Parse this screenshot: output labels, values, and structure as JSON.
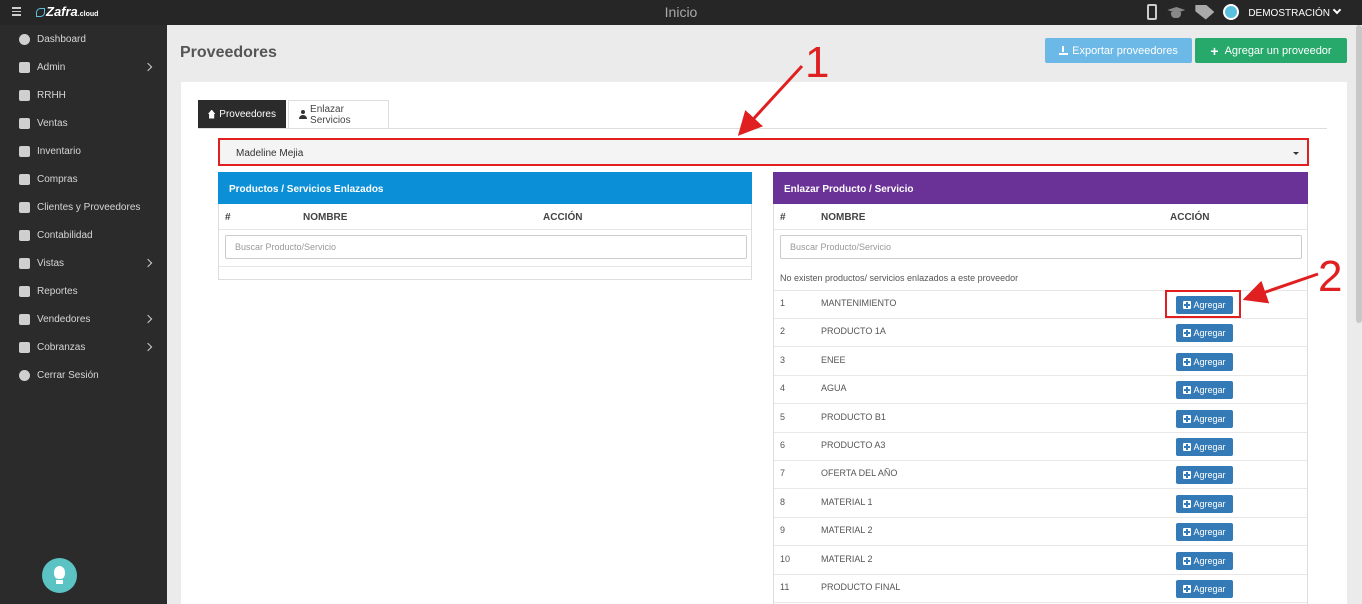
{
  "topbar": {
    "brand": "Zafra",
    "brand_suffix": ".cloud",
    "title": "Inicio",
    "user_name": "DEMOSTRACIÓN"
  },
  "sidebar": {
    "items": [
      {
        "label": "Dashboard",
        "icon": "globe-icon",
        "has_arrow": false
      },
      {
        "label": "Admin",
        "icon": "wrench-icon",
        "has_arrow": true
      },
      {
        "label": "RRHH",
        "icon": "paperclip-icon",
        "has_arrow": false
      },
      {
        "label": "Ventas",
        "icon": "money-icon",
        "has_arrow": false
      },
      {
        "label": "Inventario",
        "icon": "book-icon",
        "has_arrow": false
      },
      {
        "label": "Compras",
        "icon": "cart-icon",
        "has_arrow": false
      },
      {
        "label": "Clientes y Proveedores",
        "icon": "book-icon",
        "has_arrow": false
      },
      {
        "label": "Contabilidad",
        "icon": "paperclip-icon",
        "has_arrow": false
      },
      {
        "label": "Vistas",
        "icon": "edit-icon",
        "has_arrow": true
      },
      {
        "label": "Reportes",
        "icon": "list-icon",
        "has_arrow": false
      },
      {
        "label": "Vendedores",
        "icon": "user-icon",
        "has_arrow": true
      },
      {
        "label": "Cobranzas",
        "icon": "edit-icon",
        "has_arrow": true
      },
      {
        "label": "Cerrar Sesión",
        "icon": "power-icon",
        "has_arrow": false
      }
    ]
  },
  "header": {
    "title": "Proveedores",
    "export_label": "Exportar proveedores",
    "add_label": "Agregar un proveedor"
  },
  "tabs": {
    "active": "Proveedores",
    "inactive": "Enlazar Servicios"
  },
  "provider_select": {
    "value": "Madeline Mejia"
  },
  "left_panel": {
    "title": "Productos / Servicios Enlazados",
    "col_num": "#",
    "col_name": "NOMBRE",
    "col_action": "ACCIÓN",
    "search_placeholder": "Buscar Producto/Servicio"
  },
  "right_panel": {
    "title": "Enlazar Producto / Servicio",
    "col_num": "#",
    "col_name": "NOMBRE",
    "col_action": "ACCIÓN",
    "search_placeholder": "Buscar Producto/Servicio",
    "empty_message": "No existen productos/ servicios enlazados a este proveedor",
    "button_label": "Agregar",
    "rows": [
      {
        "num": "1",
        "name": "MANTENIMIENTO"
      },
      {
        "num": "2",
        "name": "PRODUCTO 1A"
      },
      {
        "num": "3",
        "name": "ENEE"
      },
      {
        "num": "4",
        "name": "AGUA"
      },
      {
        "num": "5",
        "name": "PRODUCTO B1"
      },
      {
        "num": "6",
        "name": "PRODUCTO A3"
      },
      {
        "num": "7",
        "name": "OFERTA DEL AÑO"
      },
      {
        "num": "8",
        "name": "MATERIAL 1"
      },
      {
        "num": "9",
        "name": "MATERIAL 2"
      },
      {
        "num": "10",
        "name": "MATERIAL 2"
      },
      {
        "num": "11",
        "name": "PRODUCTO FINAL"
      }
    ]
  },
  "annotations": {
    "label_1": "1",
    "label_2": "2",
    "color": "#e02020"
  }
}
